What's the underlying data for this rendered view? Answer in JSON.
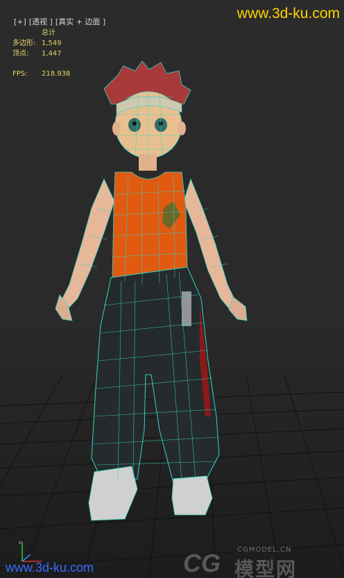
{
  "viewport_label": {
    "plus": "[+]",
    "view": "[透视 ]",
    "shading": "[真实 + 边面 ]"
  },
  "stats": {
    "header": "总计",
    "polygons_label": "多边形:",
    "polygons_value": "1,549",
    "vertices_label": "顶点:",
    "vertices_value": "1,447",
    "fps_label": "FPS:",
    "fps_value": "218.938"
  },
  "watermarks": {
    "top": "www.3d-ku.com",
    "bottom": "www.3d-ku.com",
    "cg_logo": "CG",
    "cg_site": "CGMODEL.CN",
    "cg_chinese": "模型网"
  },
  "colors": {
    "wire": "#35d6c4",
    "shirt": "#e05a12",
    "pants": "#252a2c",
    "skin": "#e7b79a",
    "stats_text": "#e8d46a",
    "top_watermark": "#ffd400",
    "bottom_watermark": "#3b6bff"
  },
  "icons": {
    "axis": "xyz-axis-icon"
  }
}
